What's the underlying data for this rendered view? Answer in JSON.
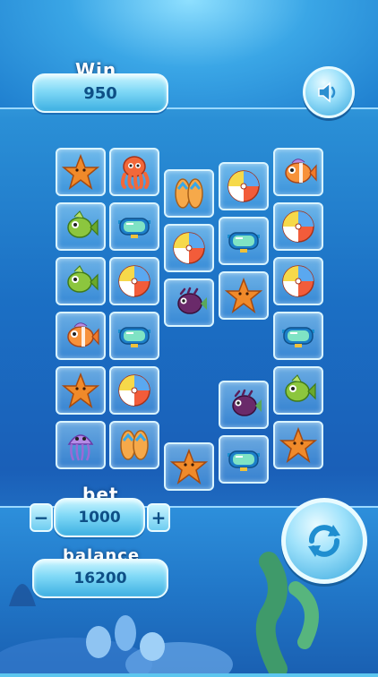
{
  "win": {
    "label": "Win",
    "value": "950"
  },
  "bet": {
    "label": "bet",
    "value": "1000",
    "minus": "−",
    "plus": "+"
  },
  "balance": {
    "label": "balance",
    "value": "16200"
  },
  "buttons": {
    "sound": "speaker-icon",
    "spin": "refresh-icon"
  },
  "board": {
    "columns": [
      [
        "starfish",
        "fish-green",
        "fish-green",
        "fish-clown",
        "starfish",
        "jellyfish"
      ],
      [
        "octopus",
        "goggles",
        "ball",
        "goggles",
        "ball",
        "flipflops"
      ],
      [
        "flipflops",
        "ball",
        "urchin-fish",
        "",
        "",
        "starfish"
      ],
      [
        "ball",
        "goggles",
        "starfish",
        "",
        "urchin-fish",
        "goggles"
      ],
      [
        "fish-clown",
        "ball",
        "ball",
        "goggles",
        "fish-green",
        "starfish"
      ]
    ]
  },
  "colors": {
    "accent": "#0e4f86",
    "panel": "#7fd8f6"
  }
}
